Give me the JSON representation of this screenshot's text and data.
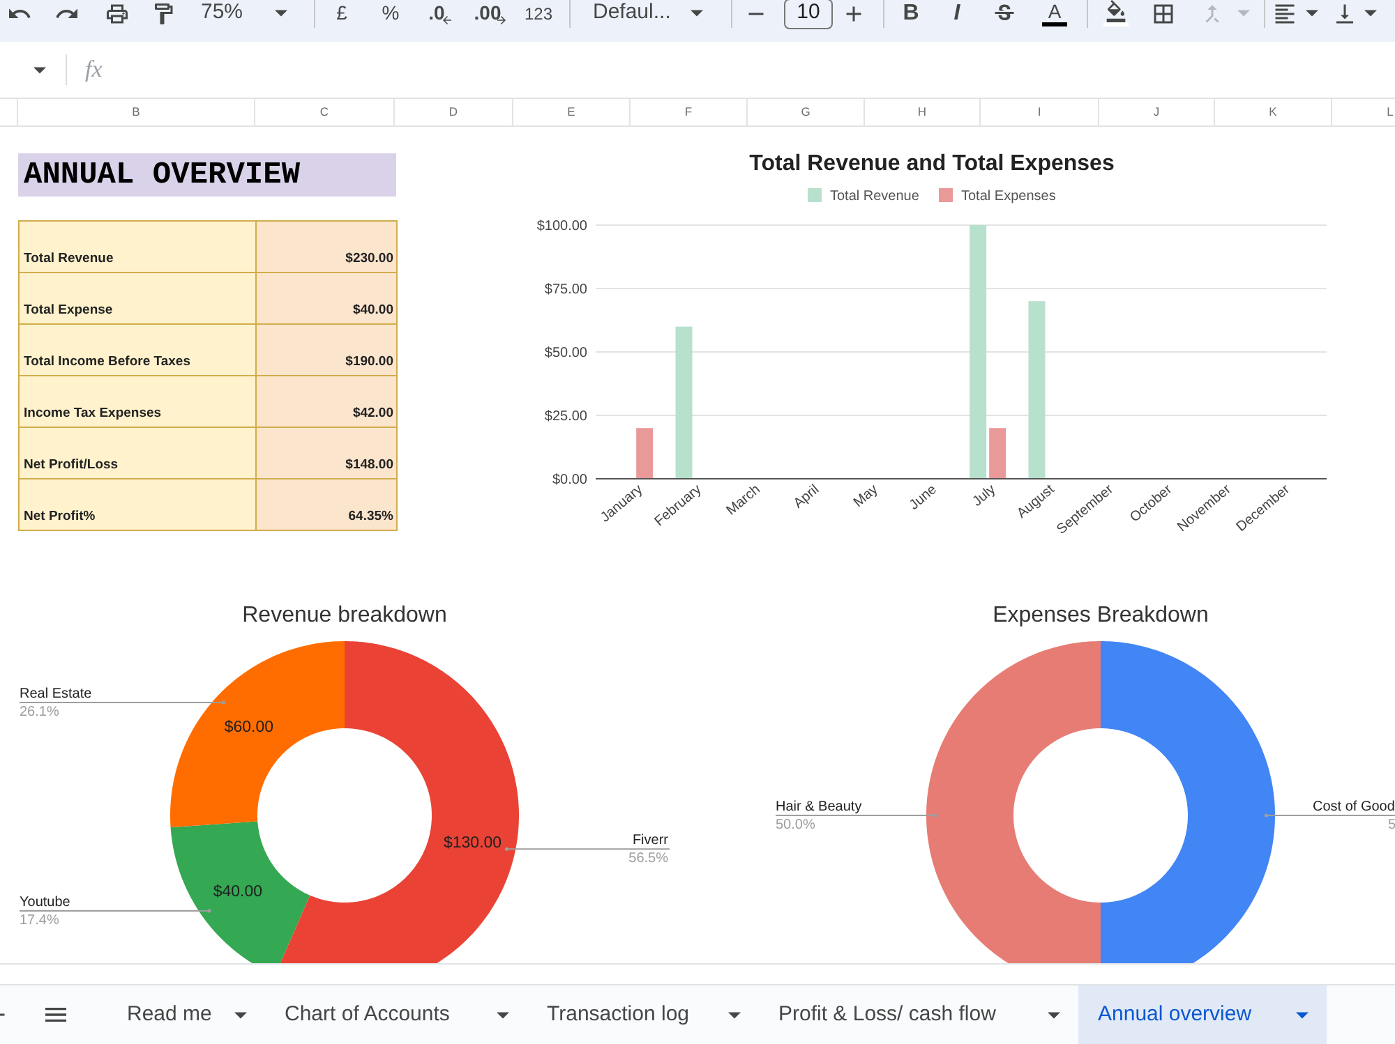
{
  "toolbar": {
    "zoom": "75%",
    "currency": "£",
    "percent": "%",
    "decrease_decimal": ".0",
    "increase_decimal": ".00",
    "number_format": "123",
    "font": "Defaul...",
    "font_size": "10",
    "bold": "B",
    "italic": "I",
    "text_color": "A",
    "merge": {
      "disabled": true
    }
  },
  "formula_bar": {
    "fx": "fx"
  },
  "column_headers": [
    "B",
    "C",
    "D",
    "E",
    "F",
    "G",
    "H",
    "I",
    "J",
    "K",
    "L"
  ],
  "sheet": {
    "title": "ANNUAL OVERVIEW",
    "summary": [
      {
        "label": "Total Revenue",
        "value": "$230.00"
      },
      {
        "label": "Total Expense",
        "value": "$40.00"
      },
      {
        "label": "Total Income Before Taxes",
        "value": "$190.00"
      },
      {
        "label": "Income Tax Expenses",
        "value": "$42.00"
      },
      {
        "label": "Net Profit/Loss",
        "value": "$148.00"
      },
      {
        "label": "Net Profit%",
        "value": "64.35%"
      }
    ]
  },
  "bar_chart": {
    "chart_data": {
      "type": "bar",
      "title": "Total Revenue and Total Expenses",
      "legend": "top",
      "categories": [
        "January",
        "February",
        "March",
        "April",
        "May",
        "June",
        "July",
        "August",
        "September",
        "October",
        "November",
        "December"
      ],
      "series": [
        {
          "name": "Total Revenue",
          "color": "#b7e1cd",
          "values": [
            0,
            60,
            0,
            0,
            0,
            0,
            100,
            70,
            0,
            0,
            0,
            0
          ]
        },
        {
          "name": "Total Expenses",
          "color": "#ea9999",
          "values": [
            20,
            0,
            0,
            0,
            0,
            0,
            20,
            0,
            0,
            0,
            0,
            0
          ]
        }
      ],
      "ylim": [
        0,
        100
      ],
      "yticks": [
        {
          "value": 0,
          "label": "$0.00"
        },
        {
          "value": 25,
          "label": "$25.00"
        },
        {
          "value": 50,
          "label": "$50.00"
        },
        {
          "value": 75,
          "label": "$75.00"
        },
        {
          "value": 100,
          "label": "$100.00"
        }
      ],
      "grid": true
    }
  },
  "revenue_chart": {
    "chart_data": {
      "type": "donut",
      "title": "Revenue breakdown",
      "categories": [
        "Fiverr",
        "Youtube",
        "Real Estate"
      ],
      "values": [
        130,
        40,
        60
      ],
      "colors": [
        "#ea4335",
        "#34a853",
        "#ff6d01"
      ],
      "value_labels": [
        "$130.00",
        "$40.00",
        "$60.00"
      ],
      "annotations": [
        "56.5%",
        "17.4%",
        "26.1%"
      ]
    }
  },
  "expenses_chart": {
    "chart_data": {
      "type": "donut",
      "title": "Expenses Breakdown",
      "categories": [
        "Cost of Good",
        "Hair & Beauty"
      ],
      "values": [
        50,
        50
      ],
      "colors": [
        "#4285f4",
        "#e67c73"
      ],
      "annotations": [
        "5",
        "50.0%"
      ]
    }
  },
  "sheet_tabs": [
    {
      "label": "Read me",
      "selected": false
    },
    {
      "label": "Chart of Accounts",
      "selected": false
    },
    {
      "label": "Transaction log",
      "selected": false
    },
    {
      "label": "Profit & Loss/ cash flow",
      "selected": false
    },
    {
      "label": "Annual overview",
      "selected": true
    }
  ]
}
